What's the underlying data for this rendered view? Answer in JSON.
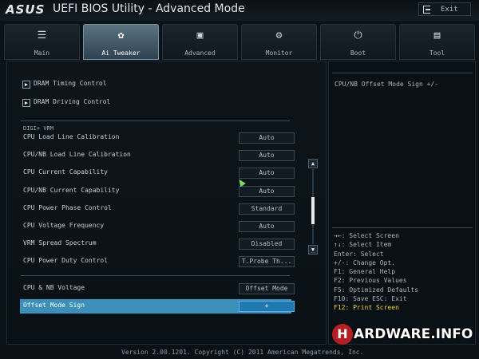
{
  "titlebar": {
    "logo": "ASUS",
    "title": "UEFI BIOS Utility - Advanced Mode",
    "exit_label": "Exit"
  },
  "tabs": [
    {
      "label": "Main",
      "icon": "list-icon",
      "active": false
    },
    {
      "label": "Ai Tweaker",
      "icon": "tweaker-icon",
      "active": true
    },
    {
      "label": "Advanced",
      "icon": "advanced-icon",
      "active": false
    },
    {
      "label": "Monitor",
      "icon": "monitor-icon",
      "active": false
    },
    {
      "label": "Boot",
      "icon": "power-icon",
      "active": false
    },
    {
      "label": "Tool",
      "icon": "tool-icon",
      "active": false
    }
  ],
  "submenus": [
    {
      "label": "DRAM Timing Control"
    },
    {
      "label": "DRAM Driving Control"
    }
  ],
  "section": {
    "heading": "DIGI+ VRM"
  },
  "settings": [
    {
      "label": "CPU Load Line Calibration",
      "value": "Auto"
    },
    {
      "label": "CPU/NB Load Line Calibration",
      "value": "Auto"
    },
    {
      "label": "CPU Current Capability",
      "value": "Auto"
    },
    {
      "label": "CPU/NB Current Capability",
      "value": "Auto"
    },
    {
      "label": "CPU Power Phase Control",
      "value": "Standard"
    },
    {
      "label": "CPU Voltage Frequency",
      "value": "Auto"
    },
    {
      "label": "VRM Spread Spectrum",
      "value": "Disabled"
    },
    {
      "label": "CPU Power Duty Control",
      "value": "T.Probe Th..."
    }
  ],
  "voltage": [
    {
      "label": "CPU & NB Voltage",
      "value": "Offset Mode"
    },
    {
      "label": "Offset Mode Sign",
      "value": "+",
      "selected": true
    }
  ],
  "help": {
    "description": "CPU/NB Offset Mode Sign +/-",
    "keys": [
      {
        "text": "→←: Select Screen",
        "highlight": false
      },
      {
        "text": "↑↓: Select Item",
        "highlight": false
      },
      {
        "text": "Enter: Select",
        "highlight": false
      },
      {
        "text": "+/-: Change Opt.",
        "highlight": false
      },
      {
        "text": "F1: General Help",
        "highlight": false
      },
      {
        "text": "F2: Previous Values",
        "highlight": false
      },
      {
        "text": "F5: Optimized Defaults",
        "highlight": false
      },
      {
        "text": "F10: Save  ESC: Exit",
        "highlight": false
      },
      {
        "text": "F12: Print Screen",
        "highlight": true
      }
    ]
  },
  "footer": {
    "version": "Version 2.00.1201. Copyright (C) 2011 American Megatrends, Inc."
  },
  "watermark": {
    "letter": "H",
    "text": "ARDWARE.INFO"
  },
  "colors": {
    "selection": "#3c8fb8",
    "highlight_key": "#f1d339",
    "active_tab": "#5a7282"
  }
}
